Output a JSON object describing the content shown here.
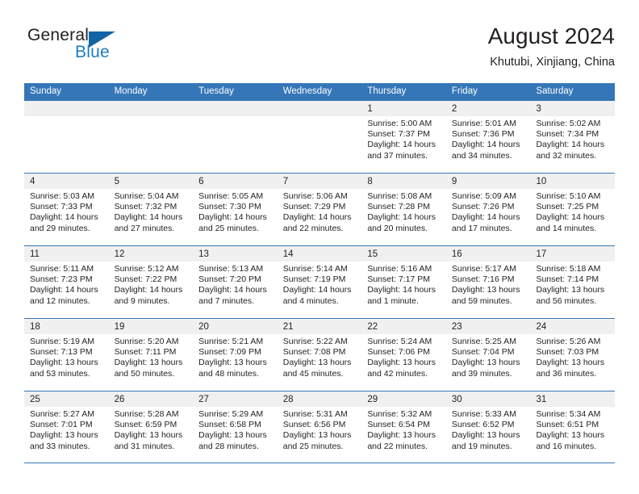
{
  "brand": {
    "name_part1": "General",
    "name_part2": "Blue",
    "logo_icon": "triangle-logo-icon"
  },
  "header": {
    "title": "August 2024",
    "location": "Khutubi, Xinjiang, China"
  },
  "colors": {
    "header_blue": "#3576b8",
    "brand_blue": "#1a7fc1",
    "logo_blue": "#1364a5",
    "daynum_bg": "#f0f0f0",
    "text": "#231f20"
  },
  "weekdays": [
    "Sunday",
    "Monday",
    "Tuesday",
    "Wednesday",
    "Thursday",
    "Friday",
    "Saturday"
  ],
  "weeks": [
    [
      {
        "day": "",
        "empty": true
      },
      {
        "day": "",
        "empty": true
      },
      {
        "day": "",
        "empty": true
      },
      {
        "day": "",
        "empty": true
      },
      {
        "day": "1",
        "sunrise": "Sunrise: 5:00 AM",
        "sunset": "Sunset: 7:37 PM",
        "daylight": "Daylight: 14 hours and 37 minutes."
      },
      {
        "day": "2",
        "sunrise": "Sunrise: 5:01 AM",
        "sunset": "Sunset: 7:36 PM",
        "daylight": "Daylight: 14 hours and 34 minutes."
      },
      {
        "day": "3",
        "sunrise": "Sunrise: 5:02 AM",
        "sunset": "Sunset: 7:34 PM",
        "daylight": "Daylight: 14 hours and 32 minutes."
      }
    ],
    [
      {
        "day": "4",
        "sunrise": "Sunrise: 5:03 AM",
        "sunset": "Sunset: 7:33 PM",
        "daylight": "Daylight: 14 hours and 29 minutes."
      },
      {
        "day": "5",
        "sunrise": "Sunrise: 5:04 AM",
        "sunset": "Sunset: 7:32 PM",
        "daylight": "Daylight: 14 hours and 27 minutes."
      },
      {
        "day": "6",
        "sunrise": "Sunrise: 5:05 AM",
        "sunset": "Sunset: 7:30 PM",
        "daylight": "Daylight: 14 hours and 25 minutes."
      },
      {
        "day": "7",
        "sunrise": "Sunrise: 5:06 AM",
        "sunset": "Sunset: 7:29 PM",
        "daylight": "Daylight: 14 hours and 22 minutes."
      },
      {
        "day": "8",
        "sunrise": "Sunrise: 5:08 AM",
        "sunset": "Sunset: 7:28 PM",
        "daylight": "Daylight: 14 hours and 20 minutes."
      },
      {
        "day": "9",
        "sunrise": "Sunrise: 5:09 AM",
        "sunset": "Sunset: 7:26 PM",
        "daylight": "Daylight: 14 hours and 17 minutes."
      },
      {
        "day": "10",
        "sunrise": "Sunrise: 5:10 AM",
        "sunset": "Sunset: 7:25 PM",
        "daylight": "Daylight: 14 hours and 14 minutes."
      }
    ],
    [
      {
        "day": "11",
        "sunrise": "Sunrise: 5:11 AM",
        "sunset": "Sunset: 7:23 PM",
        "daylight": "Daylight: 14 hours and 12 minutes."
      },
      {
        "day": "12",
        "sunrise": "Sunrise: 5:12 AM",
        "sunset": "Sunset: 7:22 PM",
        "daylight": "Daylight: 14 hours and 9 minutes."
      },
      {
        "day": "13",
        "sunrise": "Sunrise: 5:13 AM",
        "sunset": "Sunset: 7:20 PM",
        "daylight": "Daylight: 14 hours and 7 minutes."
      },
      {
        "day": "14",
        "sunrise": "Sunrise: 5:14 AM",
        "sunset": "Sunset: 7:19 PM",
        "daylight": "Daylight: 14 hours and 4 minutes."
      },
      {
        "day": "15",
        "sunrise": "Sunrise: 5:16 AM",
        "sunset": "Sunset: 7:17 PM",
        "daylight": "Daylight: 14 hours and 1 minute."
      },
      {
        "day": "16",
        "sunrise": "Sunrise: 5:17 AM",
        "sunset": "Sunset: 7:16 PM",
        "daylight": "Daylight: 13 hours and 59 minutes."
      },
      {
        "day": "17",
        "sunrise": "Sunrise: 5:18 AM",
        "sunset": "Sunset: 7:14 PM",
        "daylight": "Daylight: 13 hours and 56 minutes."
      }
    ],
    [
      {
        "day": "18",
        "sunrise": "Sunrise: 5:19 AM",
        "sunset": "Sunset: 7:13 PM",
        "daylight": "Daylight: 13 hours and 53 minutes."
      },
      {
        "day": "19",
        "sunrise": "Sunrise: 5:20 AM",
        "sunset": "Sunset: 7:11 PM",
        "daylight": "Daylight: 13 hours and 50 minutes."
      },
      {
        "day": "20",
        "sunrise": "Sunrise: 5:21 AM",
        "sunset": "Sunset: 7:09 PM",
        "daylight": "Daylight: 13 hours and 48 minutes."
      },
      {
        "day": "21",
        "sunrise": "Sunrise: 5:22 AM",
        "sunset": "Sunset: 7:08 PM",
        "daylight": "Daylight: 13 hours and 45 minutes."
      },
      {
        "day": "22",
        "sunrise": "Sunrise: 5:24 AM",
        "sunset": "Sunset: 7:06 PM",
        "daylight": "Daylight: 13 hours and 42 minutes."
      },
      {
        "day": "23",
        "sunrise": "Sunrise: 5:25 AM",
        "sunset": "Sunset: 7:04 PM",
        "daylight": "Daylight: 13 hours and 39 minutes."
      },
      {
        "day": "24",
        "sunrise": "Sunrise: 5:26 AM",
        "sunset": "Sunset: 7:03 PM",
        "daylight": "Daylight: 13 hours and 36 minutes."
      }
    ],
    [
      {
        "day": "25",
        "sunrise": "Sunrise: 5:27 AM",
        "sunset": "Sunset: 7:01 PM",
        "daylight": "Daylight: 13 hours and 33 minutes."
      },
      {
        "day": "26",
        "sunrise": "Sunrise: 5:28 AM",
        "sunset": "Sunset: 6:59 PM",
        "daylight": "Daylight: 13 hours and 31 minutes."
      },
      {
        "day": "27",
        "sunrise": "Sunrise: 5:29 AM",
        "sunset": "Sunset: 6:58 PM",
        "daylight": "Daylight: 13 hours and 28 minutes."
      },
      {
        "day": "28",
        "sunrise": "Sunrise: 5:31 AM",
        "sunset": "Sunset: 6:56 PM",
        "daylight": "Daylight: 13 hours and 25 minutes."
      },
      {
        "day": "29",
        "sunrise": "Sunrise: 5:32 AM",
        "sunset": "Sunset: 6:54 PM",
        "daylight": "Daylight: 13 hours and 22 minutes."
      },
      {
        "day": "30",
        "sunrise": "Sunrise: 5:33 AM",
        "sunset": "Sunset: 6:52 PM",
        "daylight": "Daylight: 13 hours and 19 minutes."
      },
      {
        "day": "31",
        "sunrise": "Sunrise: 5:34 AM",
        "sunset": "Sunset: 6:51 PM",
        "daylight": "Daylight: 13 hours and 16 minutes."
      }
    ]
  ]
}
